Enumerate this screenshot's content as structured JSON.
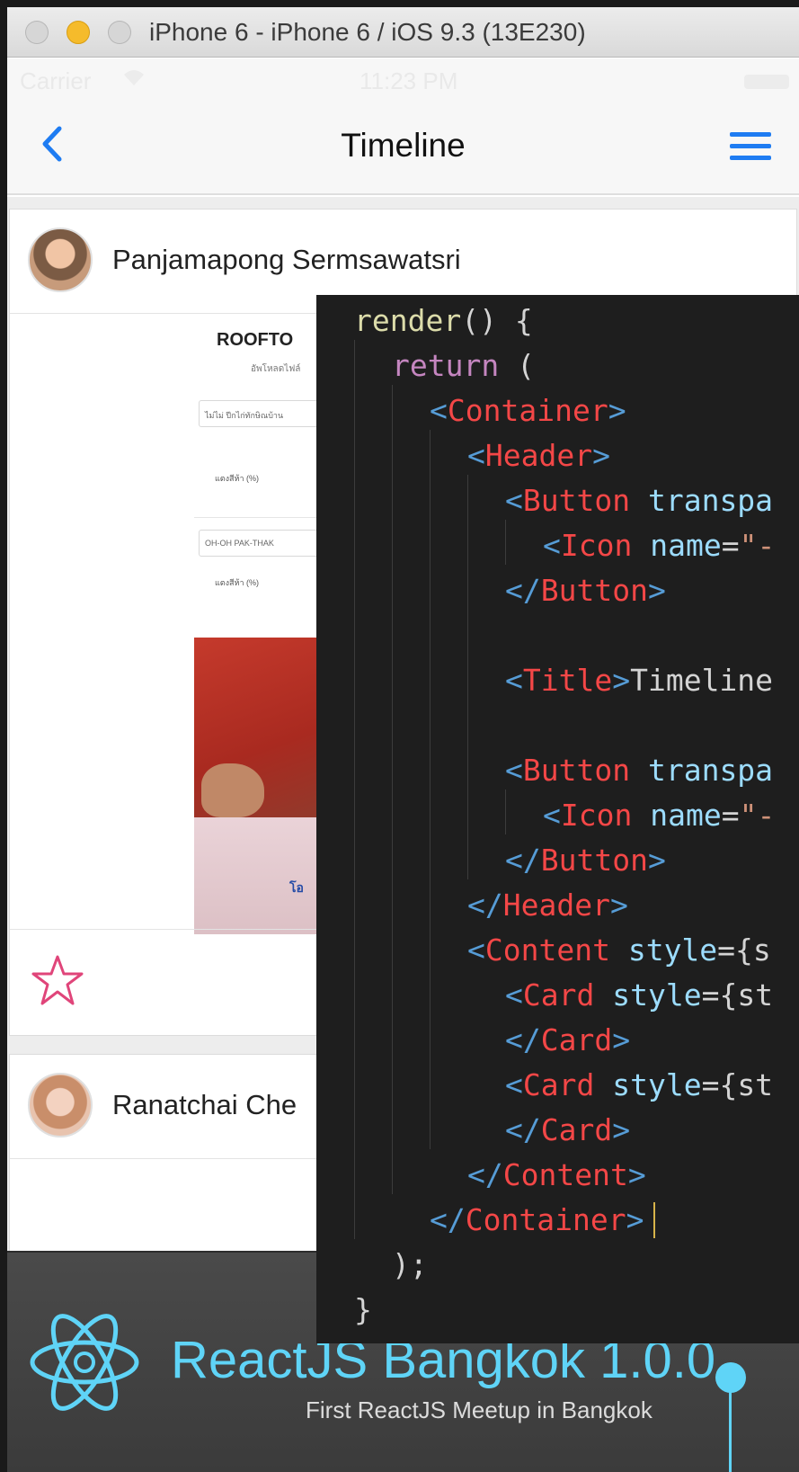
{
  "window": {
    "title": "iPhone 6 - iPhone 6 / iOS 9.3 (13E230)"
  },
  "status_bar": {
    "carrier": "Carrier",
    "time": "11:23 PM"
  },
  "navbar": {
    "title": "Timeline",
    "back_icon": "chevron-left-icon",
    "menu_icon": "hamburger-menu-icon",
    "accent_color": "#1e7cf2"
  },
  "feed": {
    "posts": [
      {
        "author": "Panjamapong Sermsawatsri",
        "image": {
          "heading": "ROOFTO",
          "subheading": "อัพโหลดไฟล์",
          "field1": "ไม่ไม่ ปีกไก่ทักษิณบ้าน",
          "label1": "แตงสีห้า (%)",
          "field2": "OH-OH PAK-THAK",
          "label2": "แตงสีห้า (%)",
          "stamp": "โอ"
        },
        "footer_icon": "star-outline-icon"
      },
      {
        "author": "Ranatchai Che"
      }
    ]
  },
  "code": {
    "lines": [
      {
        "parts": [
          {
            "c": "fn",
            "t": "render"
          },
          {
            "c": "txt",
            "t": "() {"
          }
        ]
      },
      {
        "parts": [
          {
            "c": "ctl",
            "t": "return"
          },
          {
            "c": "txt",
            "t": " ("
          }
        ]
      },
      {
        "parts": [
          {
            "c": "brk",
            "t": "<"
          },
          {
            "c": "tag",
            "t": "Container"
          },
          {
            "c": "brk",
            "t": ">"
          }
        ]
      },
      {
        "parts": [
          {
            "c": "brk",
            "t": "<"
          },
          {
            "c": "tag",
            "t": "Header"
          },
          {
            "c": "brk",
            "t": ">"
          }
        ]
      },
      {
        "parts": [
          {
            "c": "brk",
            "t": "<"
          },
          {
            "c": "tag",
            "t": "Button"
          },
          {
            "c": "txt",
            "t": " "
          },
          {
            "c": "attr",
            "t": "transpa"
          }
        ]
      },
      {
        "parts": [
          {
            "c": "brk",
            "t": "<"
          },
          {
            "c": "tag",
            "t": "Icon"
          },
          {
            "c": "txt",
            "t": " "
          },
          {
            "c": "attr",
            "t": "name"
          },
          {
            "c": "txt",
            "t": "="
          },
          {
            "c": "str",
            "t": "\"-"
          }
        ]
      },
      {
        "parts": [
          {
            "c": "brk",
            "t": "</"
          },
          {
            "c": "tag",
            "t": "Button"
          },
          {
            "c": "brk",
            "t": ">"
          }
        ]
      },
      {
        "parts": []
      },
      {
        "parts": [
          {
            "c": "brk",
            "t": "<"
          },
          {
            "c": "tag",
            "t": "Title"
          },
          {
            "c": "brk",
            "t": ">"
          },
          {
            "c": "txt",
            "t": "Timeline"
          }
        ]
      },
      {
        "parts": []
      },
      {
        "parts": [
          {
            "c": "brk",
            "t": "<"
          },
          {
            "c": "tag",
            "t": "Button"
          },
          {
            "c": "txt",
            "t": " "
          },
          {
            "c": "attr",
            "t": "transpa"
          }
        ]
      },
      {
        "parts": [
          {
            "c": "brk",
            "t": "<"
          },
          {
            "c": "tag",
            "t": "Icon"
          },
          {
            "c": "txt",
            "t": " "
          },
          {
            "c": "attr",
            "t": "name"
          },
          {
            "c": "txt",
            "t": "="
          },
          {
            "c": "str",
            "t": "\"-"
          }
        ]
      },
      {
        "parts": [
          {
            "c": "brk",
            "t": "</"
          },
          {
            "c": "tag",
            "t": "Button"
          },
          {
            "c": "brk",
            "t": ">"
          }
        ]
      },
      {
        "parts": [
          {
            "c": "brk",
            "t": "</"
          },
          {
            "c": "tag",
            "t": "Header"
          },
          {
            "c": "brk",
            "t": ">"
          }
        ]
      },
      {
        "parts": [
          {
            "c": "brk",
            "t": "<"
          },
          {
            "c": "tag",
            "t": "Content"
          },
          {
            "c": "txt",
            "t": " "
          },
          {
            "c": "attr",
            "t": "style"
          },
          {
            "c": "txt",
            "t": "={s"
          }
        ]
      },
      {
        "parts": [
          {
            "c": "brk",
            "t": "<"
          },
          {
            "c": "tag",
            "t": "Card"
          },
          {
            "c": "txt",
            "t": " "
          },
          {
            "c": "attr",
            "t": "style"
          },
          {
            "c": "txt",
            "t": "={st"
          }
        ]
      },
      {
        "parts": [
          {
            "c": "brk",
            "t": "</"
          },
          {
            "c": "tag",
            "t": "Card"
          },
          {
            "c": "brk",
            "t": ">"
          }
        ]
      },
      {
        "parts": [
          {
            "c": "brk",
            "t": "<"
          },
          {
            "c": "tag",
            "t": "Card"
          },
          {
            "c": "txt",
            "t": " "
          },
          {
            "c": "attr",
            "t": "style"
          },
          {
            "c": "txt",
            "t": "={st"
          }
        ]
      },
      {
        "parts": [
          {
            "c": "brk",
            "t": "</"
          },
          {
            "c": "tag",
            "t": "Card"
          },
          {
            "c": "brk",
            "t": ">"
          }
        ]
      },
      {
        "parts": [
          {
            "c": "brk",
            "t": "</"
          },
          {
            "c": "tag",
            "t": "Content"
          },
          {
            "c": "brk",
            "t": ">"
          }
        ]
      },
      {
        "parts": [
          {
            "c": "brk",
            "t": "</"
          },
          {
            "c": "tag",
            "t": "Container"
          },
          {
            "c": "brk",
            "t": ">"
          }
        ]
      },
      {
        "parts": [
          {
            "c": "txt",
            "t": ");"
          }
        ]
      },
      {
        "parts": [
          {
            "c": "txt",
            "t": "}"
          }
        ]
      }
    ]
  },
  "banner": {
    "title": "ReactJS Bangkok 1.0.0",
    "subtitle": "First ReactJS Meetup in Bangkok",
    "logo_icon": "react-logo-icon",
    "accent_color": "#5fd4f7"
  }
}
